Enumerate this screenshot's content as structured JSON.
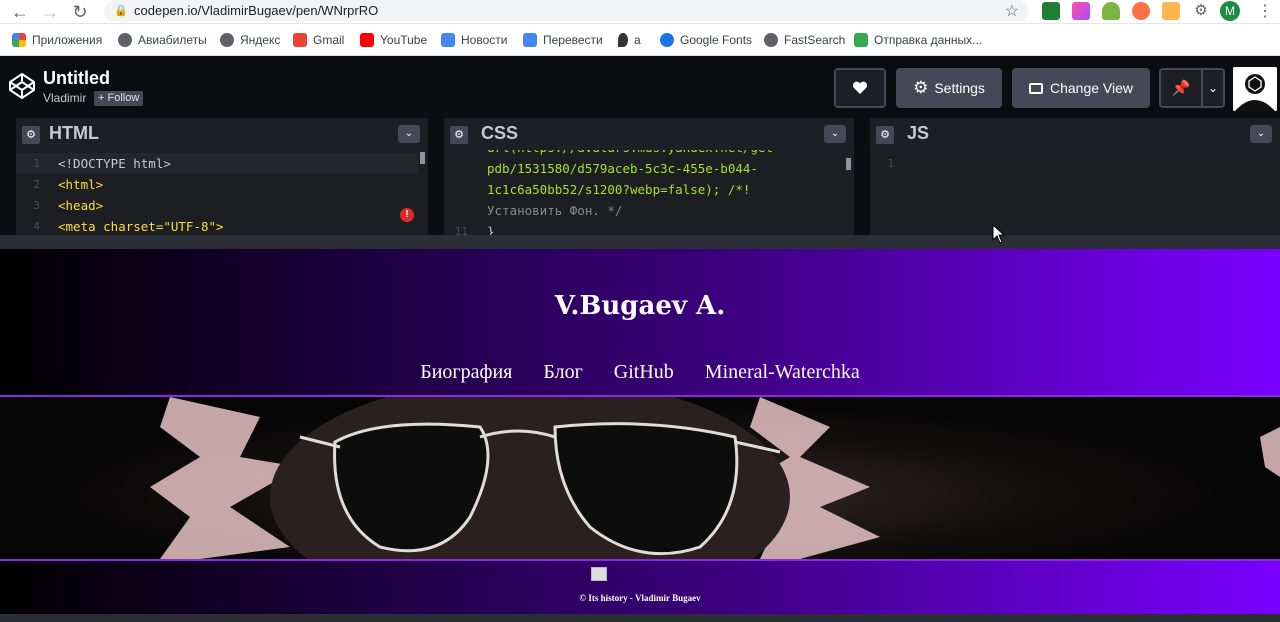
{
  "browser": {
    "url": "codepen.io/VladimirBugaev/pen/WNrprRO",
    "profile_initial": "M",
    "bookmarks": [
      {
        "label": "Приложения",
        "color": "#ea4335"
      },
      {
        "label": "Авиабилеты",
        "color": "#5f6368"
      },
      {
        "label": "Яндекс",
        "color": "#5f6368"
      },
      {
        "label": "Gmail",
        "color": "#ea4335"
      },
      {
        "label": "YouTube",
        "color": "#ff0000"
      },
      {
        "label": "Новости",
        "color": "#4285f4"
      },
      {
        "label": "Перевести",
        "color": "#4285f4"
      },
      {
        "label": "a",
        "color": "#333333"
      },
      {
        "label": "Google Fonts",
        "color": "#1a73e8"
      },
      {
        "label": "FastSearch",
        "color": "#5f6368"
      },
      {
        "label": "Отправка данных...",
        "color": "#34a853"
      }
    ]
  },
  "codepen": {
    "title": "Untitled",
    "author": "Vladimir",
    "follow_label": "+ Follow",
    "settings_label": "Settings",
    "change_view_label": "Change View"
  },
  "editors": {
    "html": {
      "title": "HTML",
      "lines": [
        {
          "num": "1",
          "text": "<!DOCTYPE html>"
        },
        {
          "num": "2",
          "text": "<html>"
        },
        {
          "num": "3",
          "text": "<head>"
        },
        {
          "num": "4",
          "text": "  <meta charset=\"UTF-8\">"
        }
      ],
      "error_mark": "!"
    },
    "css": {
      "title": "CSS",
      "lines": [
        {
          "num": "",
          "text": "url(https://avatars.mds.yandex.net/get-"
        },
        {
          "num": "",
          "text": "pdb/1531580/d579aceb-5c3c-455e-b044-"
        },
        {
          "num": "",
          "text": "1c1c6a50bb52/s1200?webp=false); /*!"
        },
        {
          "num": "",
          "text": "Установить Фон. */"
        },
        {
          "num": "11",
          "text": "}"
        }
      ]
    },
    "js": {
      "title": "JS",
      "lines": [
        {
          "num": "1",
          "text": ""
        }
      ]
    }
  },
  "preview": {
    "site_title": "V.Bugaev A.",
    "nav": [
      "Биография",
      "Блог",
      "GitHub",
      "Mineral-Waterchka"
    ],
    "footer_text": "© Its history - Vladimir Bugaev"
  }
}
